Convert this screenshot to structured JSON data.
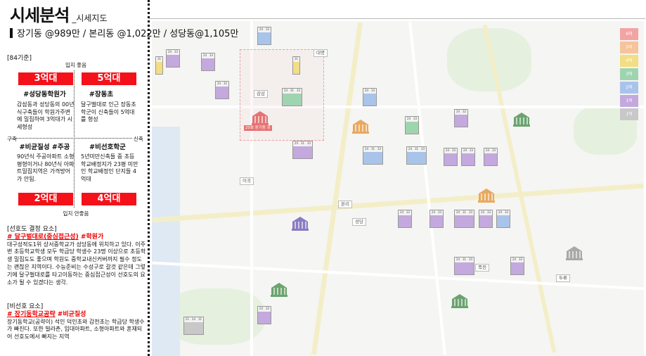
{
  "header": {
    "title": "시세분석",
    "subtitle": "_시세지도",
    "price_summary": "장기동 @989만 / 본리동 @1,022만 / 성당동@1,105만"
  },
  "matrix": {
    "tag": "[84기준]",
    "axis_top": "입지 좋음",
    "axis_bottom": "입지 안좋음",
    "axis_left": "구축",
    "axis_right": "신축",
    "quadrants": [
      {
        "price": "3억대",
        "heading": "#성당동학원가",
        "text": "감삼동과 성당동의 00년식구축들이 학원가주변에 밀집하여 3억대가 시세형성"
      },
      {
        "price": "5억대",
        "heading": "#장동초",
        "text": "달구벌대로 인근 장동초학군이 신축들이 5억대를 형성"
      },
      {
        "price": "2억대",
        "heading": "#비균질성 #주공",
        "text": "90년식 주공아파트 소형평형이거나 80년식 아파트밀집지역은 가격방어가 안됨."
      },
      {
        "price": "4억대",
        "heading": "#비선호학군",
        "text": "5년미만신축들 중 초등학교배정지가 23평 미만인 학교배정인 단지들 4억대"
      }
    ]
  },
  "preference": {
    "heading": "[선호도 결정 요소]",
    "highlight_parts": [
      "# 달구벌대로(중심접근성)",
      "#학원가"
    ],
    "text": "대구성적도1위 상서중학교가 성당동에 위치하고 있다. 이주변 초등학교학생 모두 학급당 학생수 23명 이상으로 초등학생 밀집도도 좋으며 학원도 중학교내신커버까지 필수 정도는 괜찮은 지역이다. 수능준비는 수성구로 갈것 같은데 그렇기에 달구벌대로를 타고이동하는 중심접근성이 선호도의 요소가 될 수 있겠다는 생각."
  },
  "non_preference": {
    "heading": "[비선호 요소]",
    "highlight_parts": [
      "# 장기동학교공략",
      "#비균질성"
    ],
    "text": "장기동학교(공략이) 석인 덕인초와 감천초는 학급당 학생수가 빠진다. 또한 빌라촌, 임대아파트, 소형아파트와 혼재되어 선호도에서 빠지는 지역"
  },
  "map": {
    "legend": [
      {
        "label": "6억",
        "color": "#f4a3a3"
      },
      {
        "label": "5억",
        "color": "#f5c49a"
      },
      {
        "label": "4억",
        "color": "#f3dd85"
      },
      {
        "label": "3억",
        "color": "#9fd4b0"
      },
      {
        "label": "2억",
        "color": "#a9c4ea"
      },
      {
        "label": "1억",
        "color": "#c3a9dd"
      },
      {
        "label": "1억",
        "color": "#c8c8c8"
      }
    ],
    "place_labels": [
      "대명",
      "감삼",
      "본리",
      "이곡",
      "성당",
      "죽전",
      "두류"
    ],
    "schools": [
      {
        "label": "20호 장기동 회",
        "color": "#e57373"
      },
      {
        "label": "",
        "color": "#e8a95f"
      },
      {
        "label": "",
        "color": "#e8a95f"
      },
      {
        "label": "",
        "color": "#6aa36f"
      },
      {
        "label": "",
        "color": "#8a7bc2"
      },
      {
        "label": "",
        "color": "#6aa36f"
      },
      {
        "label": "",
        "color": "#6aa36f"
      },
      {
        "label": "",
        "color": "#a9a9a9"
      }
    ],
    "apartments": [
      {
        "c": 2,
        "hdr": [
          "24",
          "33"
        ],
        "col": "#a9c4ea"
      },
      {
        "c": 2,
        "hdr": [
          "24",
          "33"
        ],
        "col": "#c3a9dd"
      },
      {
        "c": 2,
        "hdr": [
          "24",
          "33"
        ],
        "col": "#c3a9dd"
      },
      {
        "c": 1,
        "hdr": [
          "31"
        ],
        "col": "#f3dd85"
      },
      {
        "c": 2,
        "hdr": [
          "24",
          "32"
        ],
        "col": "#c3a9dd"
      },
      {
        "c": 3,
        "hdr": [
          "24",
          "31",
          "33"
        ],
        "col": "#9fd4b0"
      },
      {
        "c": 2,
        "hdr": [
          "24",
          "33"
        ],
        "col": "#a9c4ea"
      },
      {
        "c": 2,
        "hdr": [
          "24",
          "32"
        ],
        "col": "#c3a9dd"
      },
      {
        "c": 2,
        "hdr": [
          "24",
          "33"
        ],
        "col": "#9fd4b0"
      },
      {
        "c": 3,
        "hdr": [
          "24",
          "31",
          "33"
        ],
        "col": "#a9c4ea"
      },
      {
        "c": 3,
        "hdr": [
          "24",
          "31",
          "33"
        ],
        "col": "#a9c4ea"
      },
      {
        "c": 2,
        "hdr": [
          "24",
          "33"
        ],
        "col": "#c3a9dd"
      },
      {
        "c": 3,
        "hdr": [
          "24",
          "31",
          "33"
        ],
        "col": "#c3a9dd"
      },
      {
        "c": 2,
        "hdr": [
          "24",
          "33"
        ],
        "col": "#c3a9dd"
      },
      {
        "c": 2,
        "hdr": [
          "24",
          "33"
        ],
        "col": "#c3a9dd"
      },
      {
        "c": 3,
        "hdr": [
          "24",
          "31",
          "33"
        ],
        "col": "#c3a9dd"
      },
      {
        "c": 2,
        "hdr": [
          "24",
          "33"
        ],
        "col": "#c3a9dd"
      },
      {
        "c": 2,
        "hdr": [
          "24",
          "33"
        ],
        "col": "#c3a9dd"
      },
      {
        "c": 2,
        "hdr": [
          "24",
          "33"
        ],
        "col": "#c3a9dd"
      },
      {
        "c": 2,
        "hdr": [
          "24",
          "33"
        ],
        "col": "#a9c4ea"
      },
      {
        "c": 2,
        "hdr": [
          "24",
          "32"
        ],
        "col": "#c3a9dd"
      },
      {
        "c": 2,
        "hdr": [
          "24",
          "33"
        ],
        "col": "#c3a9dd"
      },
      {
        "c": 3,
        "hdr": [
          "21",
          "24",
          "31"
        ],
        "col": "#c8c8c8"
      },
      {
        "c": 2,
        "hdr": [
          "24",
          "33"
        ],
        "col": "#c3a9dd"
      },
      {
        "c": 1,
        "hdr": [
          "31"
        ],
        "col": "#f3dd85"
      },
      {
        "c": 3,
        "hdr": [
          "24",
          "31",
          "33"
        ],
        "col": "#c3a9dd"
      }
    ]
  }
}
